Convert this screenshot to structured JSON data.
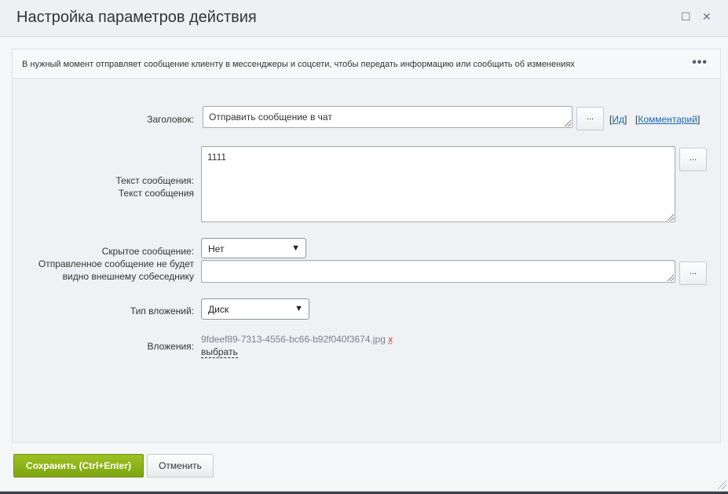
{
  "dialog": {
    "title": "Настройка параметров действия",
    "maximize_icon": "maximize-icon",
    "close_icon": "close-icon"
  },
  "description": {
    "text": "В нужный момент отправляет сообщение клиенту в мессенджеры и соцсети, чтобы передать информацию или сообщить об изменениях",
    "more_label": "•••"
  },
  "form": {
    "title_label": "Заголовок:",
    "title_value": "Отправить сообщение в чат",
    "dots_label": "...",
    "id_link_open": "[",
    "id_link": "Ид",
    "id_link_close": "]",
    "comment_link_open": "[",
    "comment_link": "Комментарий",
    "comment_link_close": "]",
    "message_label_1": "Текст сообщения:",
    "message_label_2": "Текст сообщения",
    "message_value": "1111",
    "hidden_label": "Скрытое сообщение:",
    "hidden_value": "Нет",
    "hidden_note_1": "Отправленное сообщение не будет",
    "hidden_note_2": "видно внешнему собеседнику",
    "hidden_extra_value": "",
    "attach_type_label": "Тип вложений:",
    "attach_type_value": "Диск",
    "attachments_label": "Вложения:",
    "attachment_file": "9fdeef89-7313-4556-bc66-b92f040f3674.jpg",
    "attachment_remove": "x",
    "choose_link": "выбрать"
  },
  "footer": {
    "save_label": "Сохранить (Ctrl+Enter)",
    "cancel_label": "Отменить"
  },
  "colors": {
    "save_button": "#86ad15",
    "link": "#2067b0",
    "remove": "#d33"
  }
}
